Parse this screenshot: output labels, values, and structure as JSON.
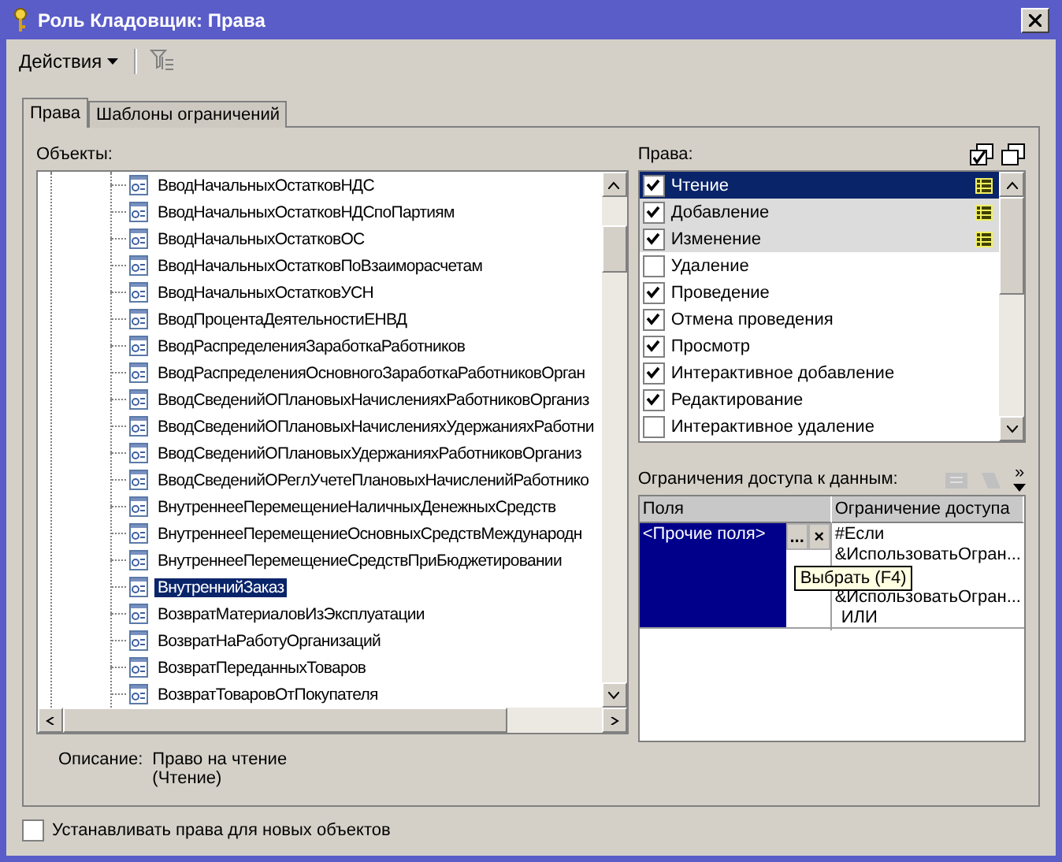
{
  "window": {
    "title": "Роль Кладовщик: Права"
  },
  "toolbar": {
    "actions_menu": "Действия"
  },
  "tabs": [
    {
      "label": "Права",
      "selected": true
    },
    {
      "label": "Шаблоны ограничений",
      "selected": false
    }
  ],
  "objects": {
    "label": "Объекты:",
    "items": [
      {
        "name": "ВводНачальныхОстатковНДС",
        "selected": false
      },
      {
        "name": "ВводНачальныхОстатковНДСпоПартиям",
        "selected": false
      },
      {
        "name": "ВводНачальныхОстатковОС",
        "selected": false
      },
      {
        "name": "ВводНачальныхОстатковПоВзаиморасчетам",
        "selected": false
      },
      {
        "name": "ВводНачальныхОстатковУСН",
        "selected": false
      },
      {
        "name": "ВводПроцентаДеятельностиЕНВД",
        "selected": false
      },
      {
        "name": "ВводРаспределенияЗаработкаРаботников",
        "selected": false
      },
      {
        "name": "ВводРаспределенияОсновногоЗаработкаРаботниковОрган",
        "selected": false
      },
      {
        "name": "ВводСведенийОПлановыхНачисленияхРаботниковОрганиз",
        "selected": false
      },
      {
        "name": "ВводСведенийОПлановыхНачисленияхУдержанияхРаботни",
        "selected": false
      },
      {
        "name": "ВводСведенийОПлановыхУдержанияхРаботниковОрганиз",
        "selected": false
      },
      {
        "name": "ВводСведенийОРеглУчетеПлановыхНачисленийРаботнико",
        "selected": false
      },
      {
        "name": "ВнутреннееПеремещениеНаличныхДенежныхСредств",
        "selected": false
      },
      {
        "name": "ВнутреннееПеремещениеОсновныхСредствМеждународн",
        "selected": false
      },
      {
        "name": "ВнутреннееПеремещениеСредствПриБюджетировании",
        "selected": false
      },
      {
        "name": "ВнутреннийЗаказ",
        "selected": true
      },
      {
        "name": "ВозвратМатериаловИзЭксплуатации",
        "selected": false
      },
      {
        "name": "ВозвратНаРаботуОрганизаций",
        "selected": false
      },
      {
        "name": "ВозвратПереданныхТоваров",
        "selected": false
      },
      {
        "name": "ВозвратТоваровОтПокупателя",
        "selected": false
      }
    ]
  },
  "description": {
    "label": "Описание:",
    "lines": [
      "Право на чтение",
      "(Чтение)"
    ]
  },
  "new_objects_checkbox": {
    "label": "Устанавливать права для новых объектов",
    "checked": false
  },
  "rights": {
    "label": "Права:",
    "items": [
      {
        "name": "Чтение",
        "checked": true,
        "selected": true,
        "has_restrictions": true
      },
      {
        "name": "Добавление",
        "checked": true,
        "selected": false,
        "has_restrictions": true
      },
      {
        "name": "Изменение",
        "checked": true,
        "selected": false,
        "has_restrictions": true
      },
      {
        "name": "Удаление",
        "checked": false,
        "selected": false,
        "has_restrictions": false
      },
      {
        "name": "Проведение",
        "checked": true,
        "selected": false,
        "has_restrictions": false
      },
      {
        "name": "Отмена проведения",
        "checked": true,
        "selected": false,
        "has_restrictions": false
      },
      {
        "name": "Просмотр",
        "checked": true,
        "selected": false,
        "has_restrictions": false
      },
      {
        "name": "Интерактивное добавление",
        "checked": true,
        "selected": false,
        "has_restrictions": false
      },
      {
        "name": "Редактирование",
        "checked": true,
        "selected": false,
        "has_restrictions": false
      },
      {
        "name": "Интерактивное удаление",
        "checked": false,
        "selected": false,
        "has_restrictions": false
      }
    ]
  },
  "restrictions": {
    "label": "Ограничения доступа к данным:",
    "more": "»",
    "columns": [
      "Поля",
      "Ограничение доступа"
    ],
    "row": {
      "field": "<Прочие поля>",
      "choose_button": "...",
      "clear_button": "×",
      "lines_above": [
        "#Если",
        "&ИспользоватьОгран..."
      ],
      "lines_below": [
        "&ИспользоватьОгран...",
        "ИЛИ"
      ]
    },
    "tooltip": "Выбрать (F4)"
  }
}
